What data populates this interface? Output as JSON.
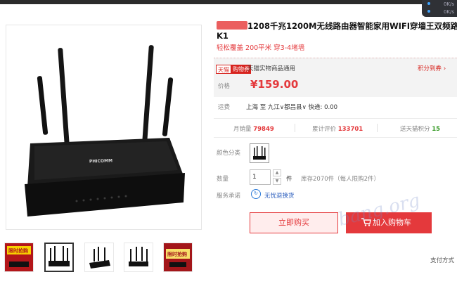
{
  "window": {
    "net_up": "0K/s",
    "net_down": "0K/s"
  },
  "product": {
    "title": "1208千兆1200M无线路由器智能家用WIFI穿墙王双频路",
    "title_line2": "K1",
    "subtitle": "轻松覆盖 200平米 穿3-4堵墙",
    "image_brand_text": "PHICOMM"
  },
  "promo": {
    "tag_part1": "天猫",
    "tag_part2": "购物券",
    "text": "天猫实物商品通用",
    "points_link": "积分到券"
  },
  "price": {
    "label": "价格",
    "value": "¥159.00"
  },
  "shipping": {
    "label": "运费",
    "value": "上海 至 九江∨都昌县∨ 快递: 0.00"
  },
  "stats": {
    "monthly_label": "月销量",
    "monthly_value": "79849",
    "reviews_label": "累计评价",
    "reviews_value": "133701",
    "points_label": "送天猫积分",
    "points_value": "15"
  },
  "options": {
    "color_label": "颜色分类",
    "qty_label": "数量",
    "qty_value": "1",
    "qty_unit": "件",
    "stock_text": "库存2070件（每人限购2件）"
  },
  "service": {
    "label": "服务承诺",
    "icon": "return-badge-icon",
    "text": "无忧退换货"
  },
  "buttons": {
    "buy_now": "立即购买",
    "add_to_cart": "加入购物车"
  },
  "footer": {
    "payment": "支付方式"
  },
  "thumbnails": [
    {
      "name": "thumb-promo-1",
      "badge": "限时抢购"
    },
    {
      "name": "thumb-router-front"
    },
    {
      "name": "thumb-router-angle"
    },
    {
      "name": "thumb-router-side"
    },
    {
      "name": "thumb-promo-2",
      "badge": "限时抢购"
    }
  ],
  "watermark": "bang.org",
  "colors": {
    "accent": "#e4393c",
    "tmall_red": "#d7231e",
    "link_blue": "#2a5dbd"
  }
}
